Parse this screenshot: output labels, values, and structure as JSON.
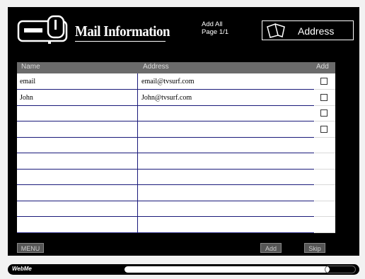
{
  "header": {
    "title": "Mail Information",
    "page_info": {
      "line1": "Add All",
      "line2": "Page 1/1"
    },
    "address_button": "Address"
  },
  "table": {
    "columns": [
      "Name",
      "Address",
      "Add"
    ],
    "rows": [
      {
        "name": "email",
        "address": "email@tvsurf.com",
        "checkbox": true
      },
      {
        "name": "John",
        "address": "John@tvsurf.com",
        "checkbox": true
      },
      {
        "name": "",
        "address": "",
        "checkbox": true
      },
      {
        "name": "",
        "address": "",
        "checkbox": true
      },
      {
        "name": "",
        "address": "",
        "checkbox": false
      },
      {
        "name": "",
        "address": "",
        "checkbox": false
      },
      {
        "name": "",
        "address": "",
        "checkbox": false
      },
      {
        "name": "",
        "address": "",
        "checkbox": false
      },
      {
        "name": "",
        "address": "",
        "checkbox": false
      },
      {
        "name": "",
        "address": "",
        "checkbox": false
      }
    ]
  },
  "footer": {
    "menu": "MENU",
    "add": "Add",
    "skip": "Skip"
  },
  "statusbar": {
    "brand": "WebMe"
  },
  "icons": [
    "mailbox-icon",
    "address-book-icon"
  ]
}
